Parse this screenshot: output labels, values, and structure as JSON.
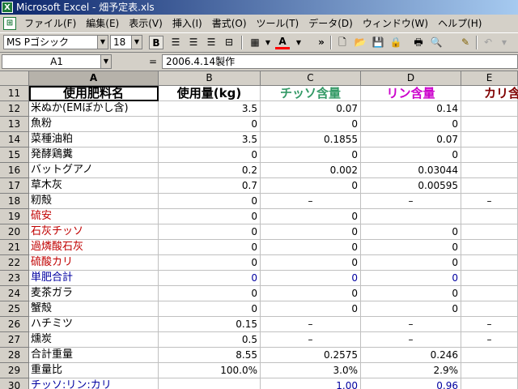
{
  "window": {
    "title": "Microsoft Excel - 畑予定表.xls",
    "app_icon": "excel-icon"
  },
  "menu": {
    "items": [
      "ファイル(F)",
      "編集(E)",
      "表示(V)",
      "挿入(I)",
      "書式(O)",
      "ツール(T)",
      "データ(D)",
      "ウィンドウ(W)",
      "ヘルプ(H)"
    ]
  },
  "toolbar": {
    "font_name": "MS Pゴシック",
    "font_size": "18",
    "bold": "B",
    "font_color_label": "A",
    "overflow": "»"
  },
  "formula_bar": {
    "name_box": "A1",
    "equals": "=",
    "value": "2006.4.14製作"
  },
  "columns": [
    "A",
    "B",
    "C",
    "D",
    "E"
  ],
  "header_row": {
    "row": "11",
    "a": "使用肥料名",
    "b": "使用量(kg)",
    "c": "チッソ含量",
    "d": "リン含量",
    "e": "カリ含"
  },
  "rows": [
    {
      "row": "12",
      "a": "米ぬか(EMぼかし含)",
      "b": "3.5",
      "c": "0.07",
      "d": "0.14",
      "e": "",
      "color": ""
    },
    {
      "row": "13",
      "a": "魚粉",
      "b": "0",
      "c": "0",
      "d": "0",
      "e": "",
      "color": ""
    },
    {
      "row": "14",
      "a": "菜種油粕",
      "b": "3.5",
      "c": "0.1855",
      "d": "0.07",
      "e": "",
      "color": ""
    },
    {
      "row": "15",
      "a": "発酵鶏糞",
      "b": "0",
      "c": "0",
      "d": "0",
      "e": "",
      "color": ""
    },
    {
      "row": "16",
      "a": "バットグアノ",
      "b": "0.2",
      "c": "0.002",
      "d": "0.03044",
      "e": "",
      "color": ""
    },
    {
      "row": "17",
      "a": "草木灰",
      "b": "0.7",
      "c": "0",
      "d": "0.00595",
      "e": "",
      "color": ""
    },
    {
      "row": "18",
      "a": "籾殻",
      "b": "0",
      "c": "–",
      "d": "–",
      "e": "–",
      "color": ""
    },
    {
      "row": "19",
      "a": "硫安",
      "b": "0",
      "c": "0",
      "d": "",
      "e": "",
      "color": "red"
    },
    {
      "row": "20",
      "a": "石灰チッソ",
      "b": "0",
      "c": "0",
      "d": "0",
      "e": "",
      "color": "red"
    },
    {
      "row": "21",
      "a": "過燐酸石灰",
      "b": "0",
      "c": "0",
      "d": "0",
      "e": "",
      "color": "red"
    },
    {
      "row": "22",
      "a": "硫酸カリ",
      "b": "0",
      "c": "0",
      "d": "0",
      "e": "",
      "color": "red"
    },
    {
      "row": "23",
      "a": "単肥合計",
      "b": "0",
      "c": "0",
      "d": "0",
      "e": "",
      "color": "blue"
    },
    {
      "row": "24",
      "a": "麦茶ガラ",
      "b": "0",
      "c": "0",
      "d": "0",
      "e": "",
      "color": ""
    },
    {
      "row": "25",
      "a": "蟹殻",
      "b": "0",
      "c": "0",
      "d": "0",
      "e": "",
      "color": ""
    },
    {
      "row": "26",
      "a": "ハチミツ",
      "b": "0.15",
      "c": "–",
      "d": "–",
      "e": "–",
      "color": ""
    },
    {
      "row": "27",
      "a": "燻炭",
      "b": "0.5",
      "c": "–",
      "d": "–",
      "e": "–",
      "color": ""
    },
    {
      "row": "28",
      "a": "合計重量",
      "b": "8.55",
      "c": "0.2575",
      "d": "0.246",
      "e": "",
      "color": ""
    },
    {
      "row": "29",
      "a": "重量比",
      "b": "100.0%",
      "c": "3.0%",
      "d": "2.9%",
      "e": "",
      "color": ""
    },
    {
      "row": "30",
      "a": "チッソ:リン:カリ",
      "b": "",
      "c": "1.00",
      "d": "0.96",
      "e": "",
      "color": "blue"
    }
  ]
}
